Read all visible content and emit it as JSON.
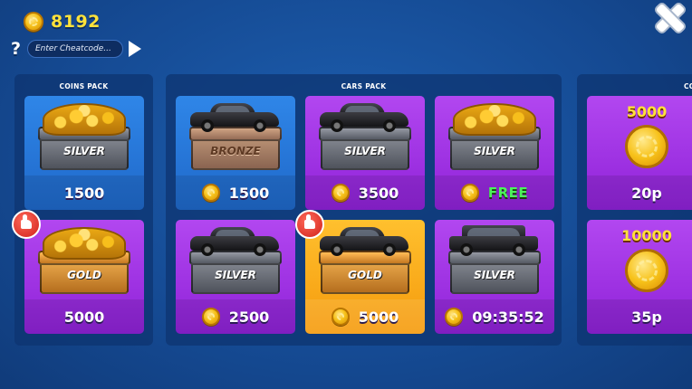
{
  "header": {
    "balance": "8192",
    "cheat_placeholder": "Enter Cheatcode...",
    "help_label": "?"
  },
  "panels": {
    "coins_pack_title": "COINS PACK",
    "cars_pack_title": "CARS PACK",
    "third_title": "CO"
  },
  "coins_pack": [
    {
      "chest": "SILVER",
      "price": "1500"
    },
    {
      "chest": "GOLD",
      "price": "5000"
    }
  ],
  "cars_pack": [
    {
      "chest": "BRONZE",
      "price": "1500",
      "card": "blue"
    },
    {
      "chest": "SILVER",
      "price": "3500",
      "card": "purple"
    },
    {
      "chest": "SILVER",
      "price": "FREE",
      "card": "purple"
    },
    {
      "chest": "SILVER",
      "price": "2500",
      "card": "purple"
    },
    {
      "chest": "GOLD",
      "price": "5000",
      "card": "orange"
    },
    {
      "chest": "SILVER",
      "price": "09:35:52",
      "card": "purple"
    }
  ],
  "coin_offers": [
    {
      "amount": "5000",
      "price": "20p"
    },
    {
      "amount": "10000",
      "price": "35p"
    }
  ],
  "icons": [
    "coin-icon",
    "help-icon",
    "play-icon",
    "close-icon",
    "thumbs-up-icon"
  ]
}
